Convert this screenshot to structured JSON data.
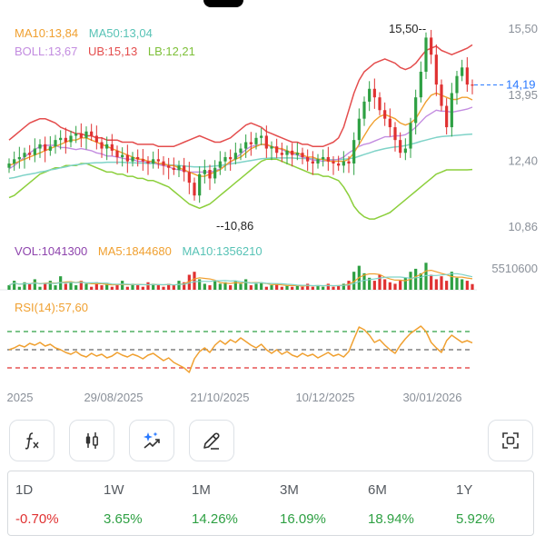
{
  "legend": {
    "ma10": "MA10:13,84",
    "ma50": "MA50:13,04",
    "boll": "BOLL:13,67",
    "ub": "UB:15,13",
    "lb": "LB:12,21"
  },
  "vol_legend": {
    "vol": "VOL:1041300",
    "ma5": "MA5:1844680",
    "ma10": "MA10:1356210"
  },
  "rsi_legend": {
    "rsi": "RSI(14):57,60"
  },
  "colors": {
    "up": "#2ea043",
    "down": "#e03131",
    "ma10": "#f0a030",
    "ma50": "#7fd3c8",
    "boll": "#c38ce0",
    "ub": "#e44d4d",
    "lb": "#8ccf3c",
    "accent": "#2979ff",
    "rsi": "#f0a030",
    "overbought": "#2ea043",
    "oversold": "#e03131"
  },
  "chart_data": {
    "type": "candlestick",
    "price_axis": {
      "ticks": [
        "15,50",
        "13,95",
        "12,40",
        "10,86"
      ],
      "ylim": [
        10.86,
        15.5
      ]
    },
    "current_price": "14,19",
    "high_marker": "15,50",
    "low_marker": "10,86",
    "date_ticks": [
      "2025",
      "29/08/2025",
      "21/10/2025",
      "10/12/2025",
      "30/01/2026"
    ],
    "volume_axis": {
      "max_label": "5510600"
    },
    "close": [
      12.35,
      12.45,
      12.5,
      12.6,
      12.55,
      12.7,
      12.8,
      12.65,
      12.75,
      12.9,
      12.95,
      12.85,
      13.0,
      13.05,
      12.95,
      13.1,
      13.0,
      12.85,
      12.7,
      12.8,
      12.65,
      12.5,
      12.55,
      12.4,
      12.5,
      12.45,
      12.4,
      12.35,
      12.45,
      12.4,
      12.3,
      12.25,
      12.2,
      12.3,
      12.15,
      11.9,
      11.6,
      12.1,
      12.2,
      12.0,
      12.25,
      12.4,
      12.5,
      12.45,
      12.6,
      12.7,
      12.85,
      12.8,
      12.95,
      13.0,
      12.7,
      12.75,
      12.6,
      12.55,
      12.65,
      12.55,
      12.6,
      12.5,
      12.4,
      12.35,
      12.45,
      12.5,
      12.4,
      12.35,
      12.3,
      12.4,
      12.35,
      12.9,
      13.4,
      13.8,
      14.1,
      13.9,
      13.6,
      13.4,
      13.2,
      12.9,
      12.6,
      12.7,
      13.3,
      13.9,
      14.5,
      15.3,
      14.9,
      14.2,
      13.7,
      13.2,
      14.0,
      14.4,
      14.6,
      14.2,
      14.19
    ],
    "ma10": [
      12.3,
      12.35,
      12.4,
      12.45,
      12.5,
      12.55,
      12.6,
      12.65,
      12.7,
      12.75,
      12.8,
      12.85,
      12.9,
      12.9,
      12.95,
      12.95,
      12.9,
      12.85,
      12.8,
      12.75,
      12.7,
      12.65,
      12.6,
      12.55,
      12.5,
      12.45,
      12.45,
      12.4,
      12.4,
      12.35,
      12.35,
      12.3,
      12.3,
      12.25,
      12.2,
      12.15,
      12.1,
      12.05,
      12.05,
      12.1,
      12.15,
      12.2,
      12.3,
      12.4,
      12.45,
      12.5,
      12.6,
      12.7,
      12.75,
      12.8,
      12.8,
      12.75,
      12.7,
      12.7,
      12.65,
      12.6,
      12.6,
      12.55,
      12.5,
      12.5,
      12.45,
      12.45,
      12.4,
      12.4,
      12.4,
      12.4,
      12.45,
      12.6,
      12.8,
      13.0,
      13.2,
      13.35,
      13.45,
      13.5,
      13.45,
      13.4,
      13.3,
      13.25,
      13.3,
      13.4,
      13.6,
      13.8,
      13.95,
      14.0,
      13.95,
      13.9,
      13.85,
      13.85,
      13.9,
      13.9,
      13.84
    ],
    "ma50": [
      12.0,
      12.02,
      12.05,
      12.08,
      12.1,
      12.12,
      12.15,
      12.17,
      12.2,
      12.22,
      12.25,
      12.27,
      12.3,
      12.32,
      12.33,
      12.35,
      12.36,
      12.37,
      12.37,
      12.38,
      12.38,
      12.38,
      12.38,
      12.37,
      12.37,
      12.36,
      12.36,
      12.35,
      12.35,
      12.34,
      12.33,
      12.32,
      12.31,
      12.3,
      12.29,
      12.28,
      12.27,
      12.27,
      12.27,
      12.28,
      12.29,
      12.3,
      12.32,
      12.34,
      12.36,
      12.38,
      12.4,
      12.42,
      12.44,
      12.46,
      12.47,
      12.48,
      12.48,
      12.48,
      12.48,
      12.48,
      12.47,
      12.47,
      12.46,
      12.46,
      12.45,
      12.45,
      12.44,
      12.44,
      12.44,
      12.45,
      12.46,
      12.48,
      12.52,
      12.56,
      12.6,
      12.64,
      12.67,
      12.7,
      12.72,
      12.74,
      12.75,
      12.77,
      12.8,
      12.83,
      12.87,
      12.9,
      12.93,
      12.96,
      12.98,
      12.99,
      13.0,
      13.01,
      13.02,
      13.03,
      13.04
    ],
    "ub": [
      12.9,
      13.0,
      13.1,
      13.2,
      13.3,
      13.35,
      13.4,
      13.4,
      13.35,
      13.3,
      13.2,
      13.15,
      13.1,
      13.05,
      13.05,
      13.0,
      13.0,
      12.95,
      12.95,
      12.9,
      12.9,
      12.9,
      12.85,
      12.85,
      12.85,
      12.8,
      12.8,
      12.8,
      12.8,
      12.75,
      12.75,
      12.75,
      12.75,
      12.8,
      12.85,
      12.9,
      12.95,
      13.0,
      12.95,
      12.9,
      12.85,
      12.85,
      12.9,
      12.95,
      13.05,
      13.15,
      13.25,
      13.3,
      13.25,
      13.2,
      13.1,
      13.05,
      13.0,
      12.95,
      12.9,
      12.85,
      12.85,
      12.8,
      12.8,
      12.75,
      12.75,
      12.75,
      12.8,
      12.85,
      12.95,
      13.2,
      13.6,
      14.0,
      14.3,
      14.5,
      14.6,
      14.7,
      14.75,
      14.8,
      14.75,
      14.7,
      14.6,
      14.55,
      14.6,
      14.7,
      14.85,
      15.0,
      15.05,
      15.1,
      15.0,
      14.95,
      14.9,
      14.95,
      15.0,
      15.05,
      15.13
    ],
    "lb": [
      11.55,
      11.6,
      11.7,
      11.8,
      11.9,
      12.0,
      12.1,
      12.15,
      12.2,
      12.25,
      12.25,
      12.3,
      12.3,
      12.3,
      12.35,
      12.35,
      12.3,
      12.25,
      12.2,
      12.15,
      12.15,
      12.1,
      12.1,
      12.05,
      12.05,
      12.0,
      12.0,
      11.95,
      11.95,
      11.9,
      11.85,
      11.8,
      11.7,
      11.6,
      11.5,
      11.4,
      11.35,
      11.3,
      11.35,
      11.4,
      11.5,
      11.6,
      11.7,
      11.8,
      11.9,
      12.0,
      12.1,
      12.2,
      12.3,
      12.4,
      12.45,
      12.45,
      12.45,
      12.4,
      12.35,
      12.3,
      12.25,
      12.2,
      12.15,
      12.1,
      12.1,
      12.05,
      12.05,
      12.0,
      11.95,
      11.8,
      11.6,
      11.35,
      11.2,
      11.1,
      11.05,
      11.05,
      11.1,
      11.15,
      11.2,
      11.3,
      11.4,
      11.5,
      11.6,
      11.7,
      11.8,
      11.9,
      12.0,
      12.1,
      12.15,
      12.2,
      12.2,
      12.2,
      12.2,
      12.2,
      12.21
    ],
    "volume": [
      0.15,
      0.3,
      0.1,
      0.25,
      0.2,
      0.35,
      0.1,
      0.2,
      0.3,
      0.15,
      0.45,
      0.2,
      0.25,
      0.15,
      0.3,
      0.2,
      0.1,
      0.25,
      0.15,
      0.2,
      0.1,
      0.15,
      0.3,
      0.1,
      0.2,
      0.15,
      0.1,
      0.25,
      0.2,
      0.15,
      0.1,
      0.2,
      0.15,
      0.3,
      0.25,
      0.5,
      0.6,
      0.35,
      0.2,
      0.15,
      0.3,
      0.2,
      0.25,
      0.15,
      0.3,
      0.2,
      0.35,
      0.15,
      0.2,
      0.25,
      0.1,
      0.15,
      0.2,
      0.1,
      0.15,
      0.1,
      0.15,
      0.1,
      0.2,
      0.1,
      0.15,
      0.1,
      0.2,
      0.1,
      0.15,
      0.2,
      0.3,
      0.6,
      0.8,
      0.55,
      0.4,
      0.3,
      0.5,
      0.35,
      0.25,
      0.2,
      0.3,
      0.4,
      0.6,
      0.7,
      0.55,
      0.9,
      0.5,
      0.35,
      0.45,
      0.3,
      0.6,
      0.4,
      0.35,
      0.3,
      0.19
    ],
    "rsi": [
      50,
      52,
      55,
      53,
      57,
      55,
      58,
      54,
      56,
      52,
      50,
      47,
      45,
      48,
      44,
      42,
      46,
      43,
      45,
      41,
      43,
      47,
      44,
      42,
      45,
      43,
      40,
      44,
      46,
      42,
      38,
      41,
      36,
      33,
      30,
      25,
      40,
      48,
      52,
      47,
      55,
      60,
      56,
      61,
      58,
      63,
      59,
      55,
      52,
      56,
      50,
      46,
      50,
      45,
      48,
      44,
      42,
      46,
      43,
      45,
      41,
      44,
      47,
      43,
      45,
      42,
      48,
      62,
      75,
      72,
      66,
      58,
      61,
      55,
      50,
      46,
      55,
      62,
      68,
      72,
      76,
      70,
      58,
      52,
      47,
      60,
      66,
      62,
      58,
      60,
      57.6
    ],
    "rsi_levels": {
      "overbought": 70,
      "middle": 50,
      "oversold": 30
    }
  },
  "toolbar": [
    {
      "name": "indicator-button",
      "icon": "function-icon"
    },
    {
      "name": "candle-type-button",
      "icon": "candlestick-icon"
    },
    {
      "name": "ai-analysis-button",
      "icon": "sparkle-chart-icon"
    },
    {
      "name": "draw-button",
      "icon": "pencil-icon"
    },
    {
      "name": "fullscreen-button",
      "icon": "expand-icon"
    }
  ],
  "performance": [
    {
      "label": "1D",
      "value": "-0.70%",
      "trend": "down"
    },
    {
      "label": "1W",
      "value": "3.65%",
      "trend": "up"
    },
    {
      "label": "1M",
      "value": "14.26%",
      "trend": "up"
    },
    {
      "label": "3M",
      "value": "16.09%",
      "trend": "up"
    },
    {
      "label": "6M",
      "value": "18.94%",
      "trend": "up"
    },
    {
      "label": "1Y",
      "value": "5.92%",
      "trend": "up"
    }
  ]
}
